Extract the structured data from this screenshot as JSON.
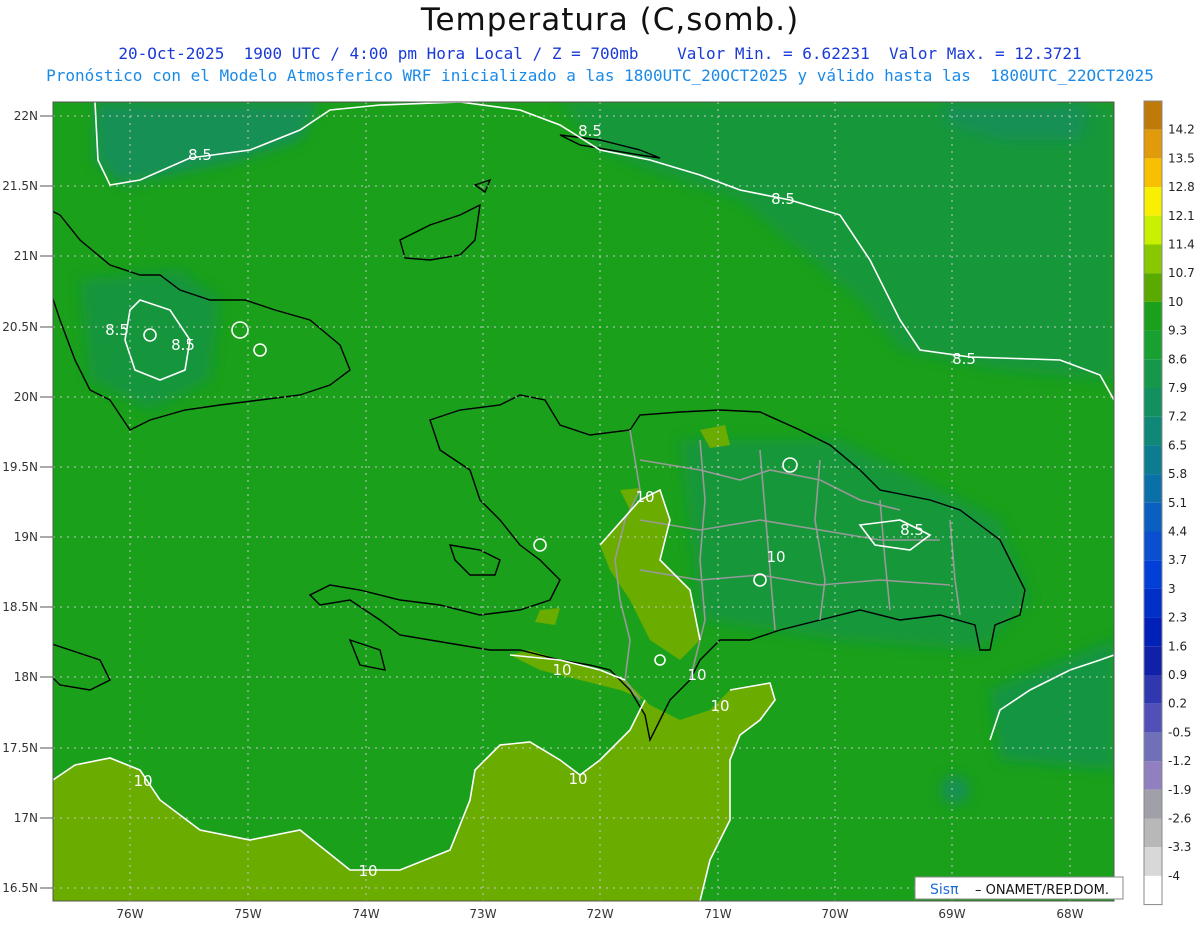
{
  "title": "Temperatura (C,somb.)",
  "subtitle_1": "20-Oct-2025  1900 UTC / 4:00 pm Hora Local / Z = 700mb    Valor Min. = 6.62231  Valor Max. = 12.3721",
  "subtitle_2": "Pronóstico con el Modelo Atmosferico WRF inicializado a las 1800UTC_20OCT2025 y válido hasta las  1800UTC_22OCT2025",
  "credit": {
    "logo": "Sisπ",
    "text": "– ONAMET/REP.DOM."
  },
  "lat_labels": [
    "22N",
    "21.5N",
    "21N",
    "20.5N",
    "20N",
    "19.5N",
    "19N",
    "18.5N",
    "18N",
    "17.5N",
    "17N",
    "16.5N"
  ],
  "lon_labels": [
    "76W",
    "75W",
    "74W",
    "73W",
    "72W",
    "71W",
    "70W",
    "69W",
    "68W"
  ],
  "colorbar": {
    "labels": [
      "14.2",
      "13.5",
      "12.8",
      "12.1",
      "11.4",
      "10.7",
      "10",
      "9.3",
      "8.6",
      "7.9",
      "7.2",
      "6.5",
      "5.8",
      "5.1",
      "4.4",
      "3.7",
      "3",
      "2.3",
      "1.6",
      "0.9",
      "0.2",
      "-0.5",
      "-1.2",
      "-1.9",
      "-2.6",
      "-3.3",
      "-4"
    ],
    "colors": [
      "#c07a0a",
      "#e09a0a",
      "#f8c000",
      "#f8f000",
      "#c8f000",
      "#88c800",
      "#5aaa00",
      "#1aa01a",
      "#18a030",
      "#16984a",
      "#129060",
      "#108878",
      "#0e7c90",
      "#0c70a8",
      "#0a60c0",
      "#0850d0",
      "#0040d8",
      "#0030c8",
      "#0020b8",
      "#1020a8",
      "#3038b0",
      "#5050b8",
      "#7070b8",
      "#9080c0",
      "#a0a0a8",
      "#b8b8b8",
      "#d8d8d8",
      "#ffffff"
    ]
  },
  "contour_labels": [
    {
      "text": "8.5",
      "id": "c1"
    },
    {
      "text": "8.5",
      "id": "c2"
    },
    {
      "text": "8.5",
      "id": "c3"
    },
    {
      "text": "8.5",
      "id": "c4"
    },
    {
      "text": "8.5",
      "id": "c5"
    },
    {
      "text": "8.5",
      "id": "c6"
    },
    {
      "text": "8.5",
      "id": "c7"
    },
    {
      "text": "10",
      "id": "c8"
    },
    {
      "text": "10",
      "id": "c9"
    },
    {
      "text": "10",
      "id": "c10"
    },
    {
      "text": "10",
      "id": "c11"
    },
    {
      "text": "10",
      "id": "c12"
    },
    {
      "text": "10",
      "id": "c13"
    },
    {
      "text": "10",
      "id": "c14"
    },
    {
      "text": "10",
      "id": "c15"
    }
  ],
  "colors": {
    "land_green": "#1aa01a",
    "warm_olive": "#6aac00",
    "cool_dark": "#108a50",
    "contour": "#ffffff",
    "coast": "#000000",
    "border": "#999999"
  }
}
